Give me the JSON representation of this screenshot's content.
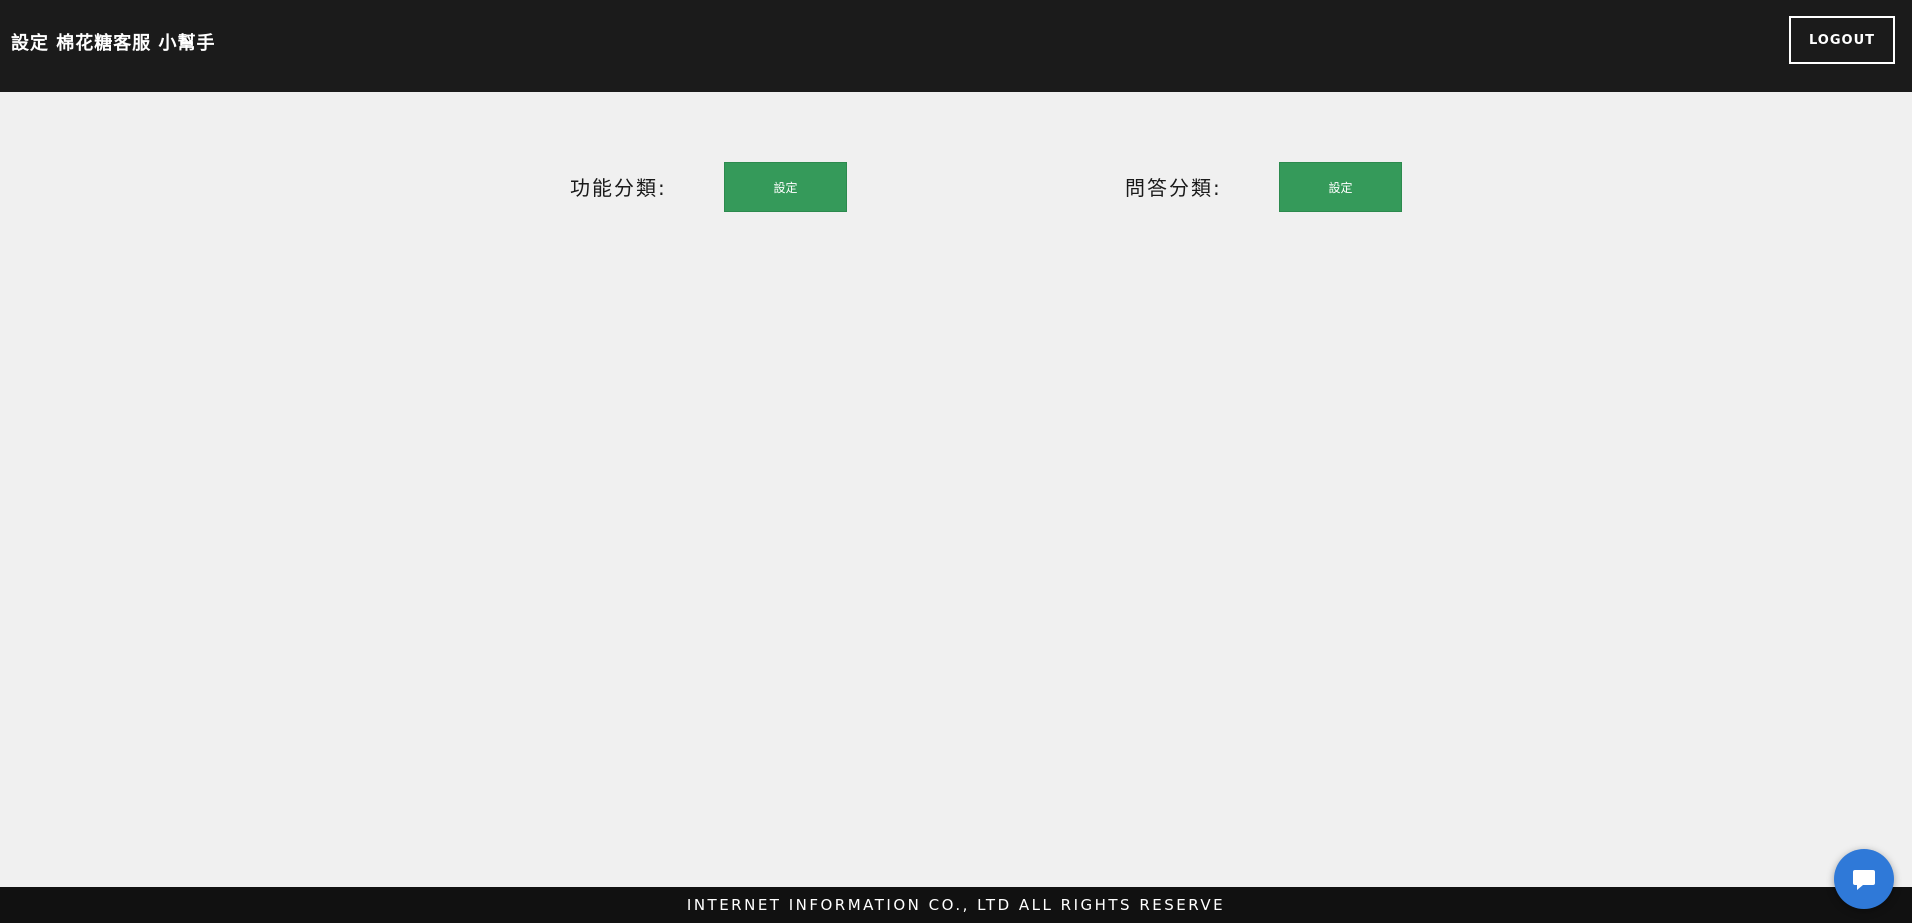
{
  "header": {
    "title": "設定 棉花糖客服 小幫手",
    "logout_label": "LOGOUT"
  },
  "main": {
    "function_category": {
      "label": "功能分類:",
      "button_label": "設定"
    },
    "qa_category": {
      "label": "問答分類:",
      "button_label": "設定"
    }
  },
  "footer": {
    "text": "INTERNET INFORMATION CO., LTD ALL RIGHTS RESERVE"
  },
  "chat_widget": {
    "icon": "chat-bubble-icon"
  },
  "colors": {
    "header_bg": "#1b1b1b",
    "page_bg": "#f0f0f0",
    "button_green": "#359a5a",
    "footer_bg": "#111111",
    "chat_blue": "#2f79d8"
  }
}
